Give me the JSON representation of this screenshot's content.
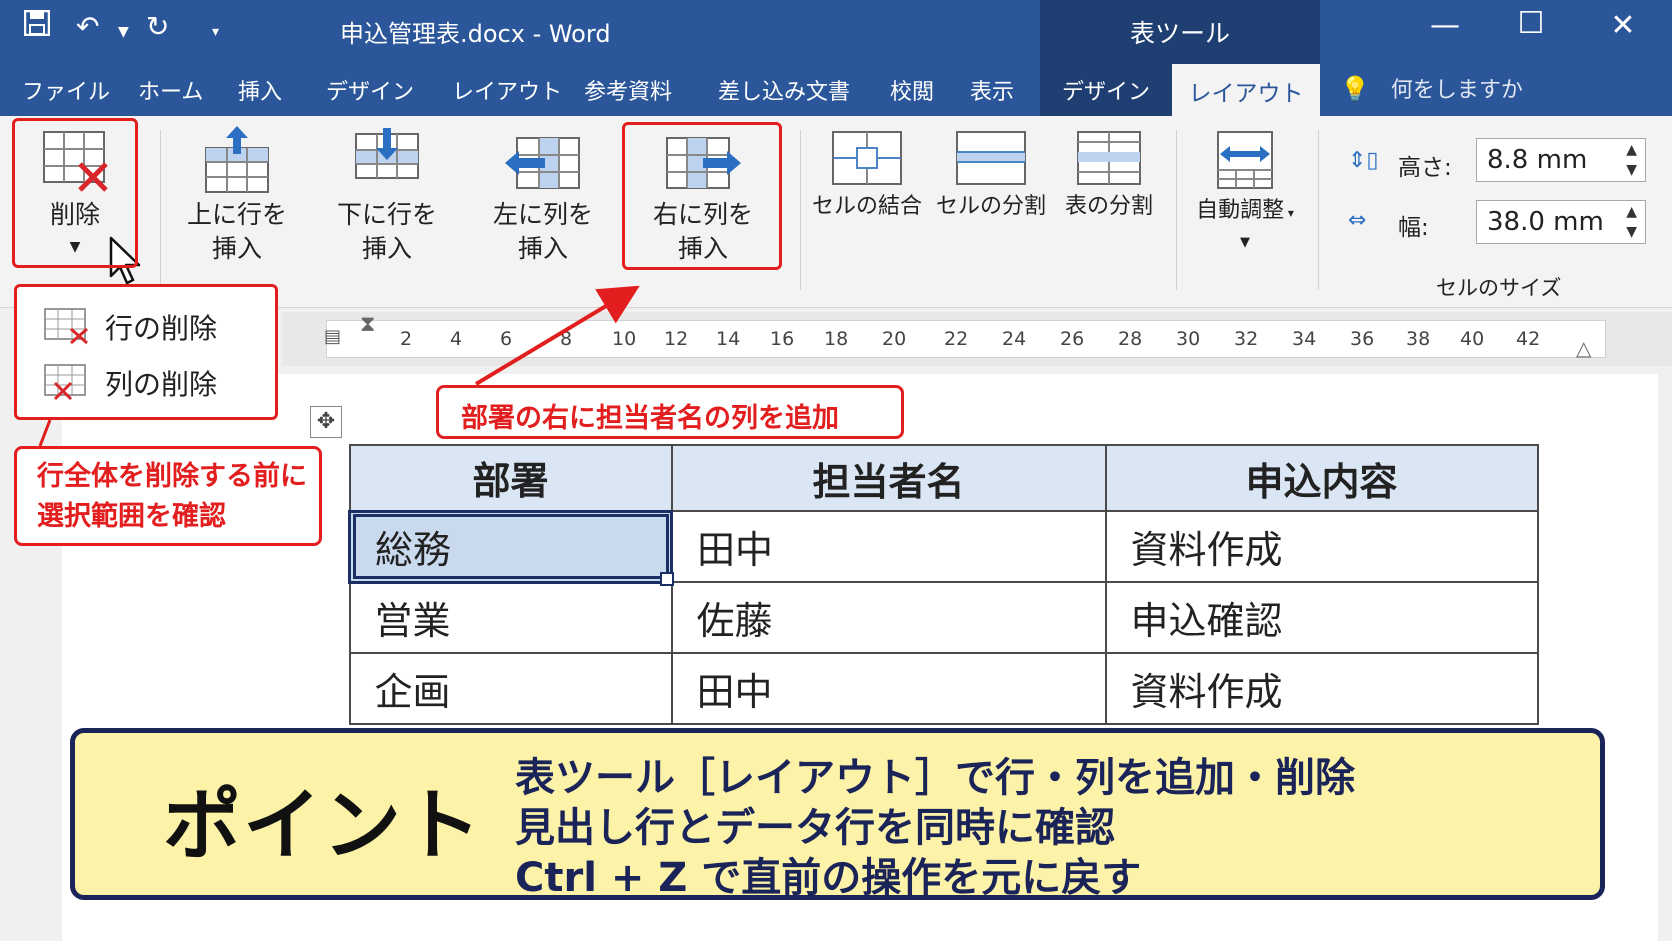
{
  "titlebar": {
    "doc_title": "申込管理表.docx - Word",
    "tools_title": "表ツール",
    "colors": {
      "bar": "#2b579a",
      "tools": "#1f3f72"
    }
  },
  "tabs": {
    "file": "ファイル",
    "home": "ホーム",
    "insert": "挿入",
    "design": "デザイン",
    "layout": "レイアウト",
    "references": "参考資料",
    "mailings": "差し込み文書",
    "review": "校閲",
    "view": "表示",
    "table_design": "デザイン",
    "table_layout": "レイアウト",
    "tell_me": "何をしますか"
  },
  "ribbon": {
    "delete": "削除",
    "insert_above_1": "上に行を",
    "insert_above_2": "挿入",
    "insert_below_1": "下に行を",
    "insert_below_2": "挿入",
    "insert_left_1": "左に列を",
    "insert_left_2": "挿入",
    "insert_right_1": "右に列を",
    "insert_right_2": "挿入",
    "merge_cells": "セルの結合",
    "split_cells": "セルの分割",
    "split_table": "表の分割",
    "autofit": "自動調整",
    "height_label": "高さ:",
    "height_value": "8.8 mm",
    "width_label": "幅:",
    "width_value": "38.0 mm",
    "cell_size_group": "セルのサイズ"
  },
  "delete_menu": {
    "delete_rows": "行の削除",
    "delete_columns": "列の削除"
  },
  "ruler": [
    "2",
    "4",
    "6",
    "8",
    "10",
    "12",
    "14",
    "16",
    "18",
    "20",
    "22",
    "24",
    "26",
    "28",
    "30",
    "32",
    "34",
    "36",
    "38",
    "40",
    "42"
  ],
  "table": {
    "headers": [
      "部署",
      "担当者名",
      "申込内容"
    ],
    "rows": [
      [
        "総務",
        "田中",
        "資料作成"
      ],
      [
        "営業",
        "佐藤",
        "申込確認"
      ],
      [
        "企画",
        "田中",
        "資料作成"
      ]
    ]
  },
  "notes": {
    "add_column": "部署の右に担当者名の列を追加",
    "delete_line1": "行全体を削除する前に",
    "delete_line2": "選択範囲を確認"
  },
  "point": {
    "title": "ポイント",
    "line1": "表ツール［レイアウト］で行・列を追加・削除",
    "line2": "見出し行とデータ行を同時に確認",
    "line3": "Ctrl + Z で直前の操作を元に戻す"
  },
  "accent_red": "#e21e1e"
}
